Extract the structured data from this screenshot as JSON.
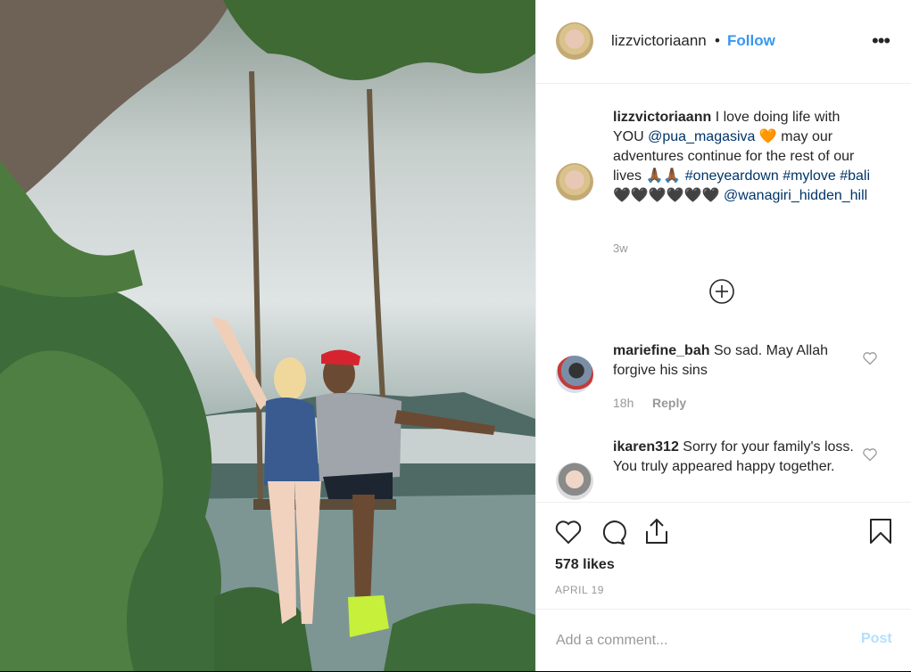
{
  "post": {
    "username": "lizzvictoriaann",
    "separator": "•",
    "follow_label": "Follow",
    "more_icon": "more-horizontal-icon",
    "more_glyph": "•••"
  },
  "caption": {
    "username": "lizzvictoriaann",
    "text_1": "I love doing life with YOU",
    "mention_1": "@pua_magasiva",
    "emoji_heart": "🧡",
    "text_2": "may our adventures continue for the rest of our lives",
    "emoji_pray": "🙏🏾🙏🏾",
    "hashtag_1": "#oneyeardown",
    "hashtag_2": "#mylove",
    "hashtag_3": "#bali",
    "emoji_hearts": "🖤🖤🖤🖤🖤🖤",
    "mention_2": "@wanagiri_hidden_hill",
    "time": "3w"
  },
  "load_more_icon": "plus-circle-icon",
  "comments": [
    {
      "username": "mariefine_bah",
      "text": "So sad. May Allah forgive his sins",
      "time": "18h",
      "reply_label": "Reply"
    },
    {
      "username": "ikaren312",
      "text": "Sorry for your family's loss. You truly appeared happy together."
    }
  ],
  "actions": {
    "like_icon": "heart-icon",
    "comment_icon": "comment-bubble-icon",
    "share_icon": "share-icon",
    "save_icon": "bookmark-icon",
    "likes": "578 likes",
    "date": "APRIL 19"
  },
  "add_comment": {
    "placeholder": "Add a comment...",
    "post_label": "Post"
  },
  "colors": {
    "link_blue": "#3897f0",
    "hashtag_navy": "#003569",
    "muted": "#999999",
    "post_disabled": "#b2dffc"
  }
}
